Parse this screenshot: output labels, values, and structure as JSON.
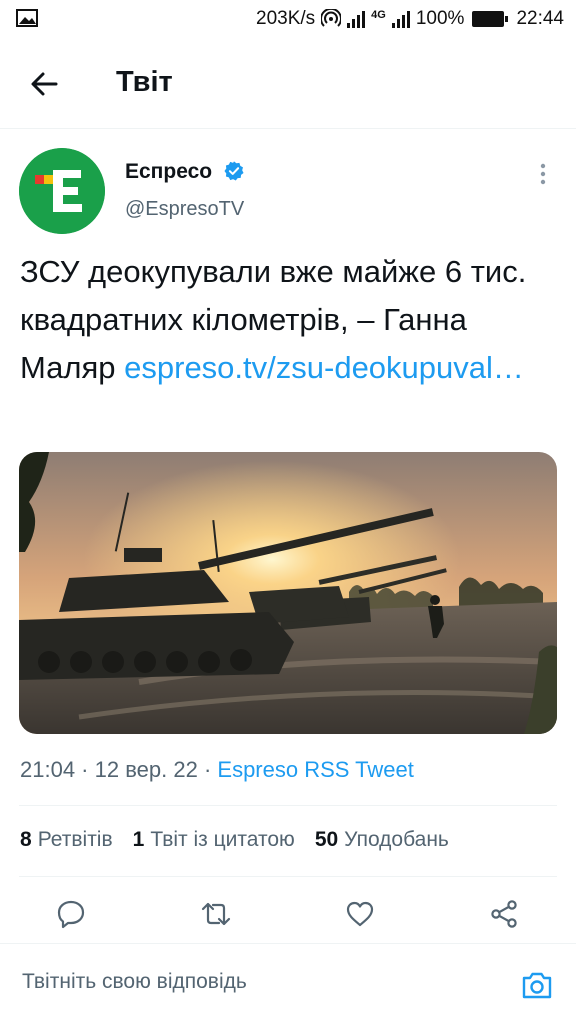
{
  "status_bar": {
    "speed": "203K/s",
    "network": "4G",
    "battery": "100%",
    "time": "22:44",
    "icons": [
      "image-icon",
      "hotspot-icon",
      "signal-icon",
      "battery-icon"
    ]
  },
  "header": {
    "title": "Твіт",
    "back_icon": "arrow-left-icon"
  },
  "author": {
    "name": "Еспресо",
    "handle": "@EspresoTV",
    "verified": true,
    "avatar_letter": "Е",
    "brand_color": "#1aa04a"
  },
  "tweet": {
    "text": "ЗСУ деокупували вже майже 6 тис. квадратних кілометрів, – Ганна Маляр ",
    "link": "espreso.tv/zsu-deokupuval…"
  },
  "meta": {
    "time": "21:04",
    "separator1": " · ",
    "date": "12 вер. 22",
    "separator2": " · ",
    "source": "Espreso RSS Tweet"
  },
  "stats": {
    "retweets_count": "8",
    "retweets_label": "Ретвітів",
    "quotes_count": "1",
    "quotes_label": "Твіт із цитатою",
    "likes_count": "50",
    "likes_label": "Уподобань"
  },
  "actions": [
    "reply-icon",
    "retweet-icon",
    "like-icon",
    "share-icon"
  ],
  "reply": {
    "placeholder": "Твітніть свою відповідь"
  },
  "colors": {
    "accent": "#1d9bf0",
    "secondary_text": "#536471",
    "divider": "#eff3f4"
  }
}
